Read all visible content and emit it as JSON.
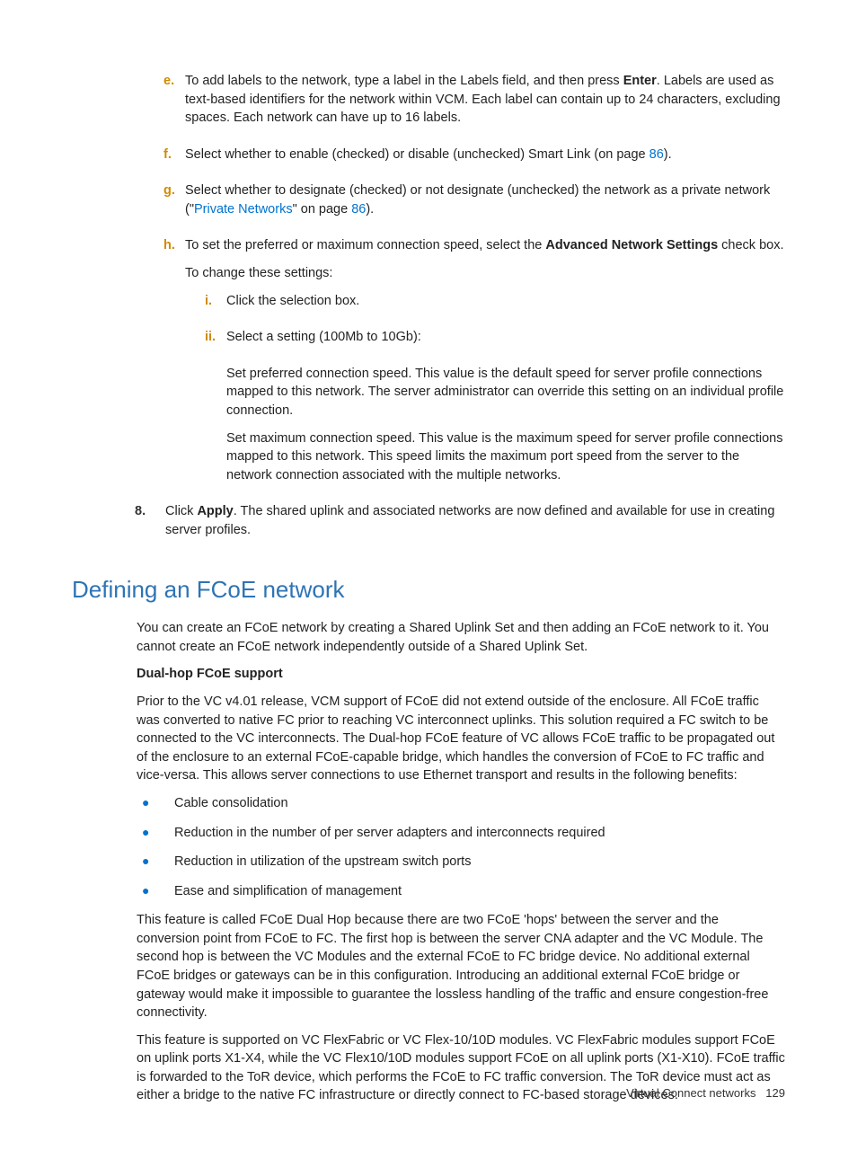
{
  "steps": {
    "e": {
      "marker": "e.",
      "text_pre": "To add labels to the network, type a label in the Labels field, and then press ",
      "bold": "Enter",
      "text_post": ". Labels are used as text-based identifiers for the network within VCM. Each label can contain up to 24 characters, excluding spaces. Each network can have up to 16 labels."
    },
    "f": {
      "marker": "f.",
      "text_pre": "Select whether to enable (checked) or disable (unchecked) Smart Link (on page ",
      "link": "86",
      "text_post": ")."
    },
    "g": {
      "marker": "g.",
      "text_pre": "Select whether to designate (checked) or not designate (unchecked) the network as a private network (\"",
      "link1": "Private Networks",
      "mid": "\" on page ",
      "link2": "86",
      "text_post": ")."
    },
    "h": {
      "marker": "h.",
      "text_pre": "To set the preferred or maximum connection speed, select the ",
      "bold": "Advanced Network Settings",
      "text_post": " check box.",
      "sub_intro": "To change these settings:",
      "i": {
        "marker": "i.",
        "text": "Click the selection box."
      },
      "ii": {
        "marker": "ii.",
        "text": "Select a setting (100Mb to 10Gb):",
        "p1": "Set preferred connection speed. This value is the default speed for server profile connections mapped to this network. The server administrator can override this setting on an individual profile connection.",
        "p2": "Set maximum connection speed. This value is the maximum speed for server profile connections mapped to this network. This speed limits the maximum port speed from the server to the network connection associated with the multiple networks."
      }
    },
    "s8": {
      "marker": "8.",
      "text_pre": "Click ",
      "bold": "Apply",
      "text_post": ". The shared uplink and associated networks are now defined and available for use in creating server profiles."
    }
  },
  "heading": "Defining an FCoE network",
  "body": {
    "p1": "You can create an FCoE network by creating a Shared Uplink Set and then adding an FCoE network to it. You cannot create an FCoE network independently outside of a Shared Uplink Set.",
    "sub": "Dual-hop FCoE support",
    "p2": "Prior to the VC v4.01 release, VCM support of FCoE did not extend outside of the enclosure. All FCoE traffic was converted to native FC prior to reaching VC interconnect uplinks. This solution required a FC switch to be connected to the VC interconnects. The Dual-hop FCoE feature of VC allows FCoE traffic to be propagated out of the enclosure to an external FCoE-capable bridge, which handles the conversion of FCoE to FC traffic and vice-versa. This allows server connections to use Ethernet transport and results in the following benefits:",
    "bullets": [
      "Cable consolidation",
      "Reduction in the number of per server adapters and interconnects required",
      "Reduction in utilization of the upstream switch ports",
      "Ease and simplification of management"
    ],
    "p3": "This feature is called FCoE Dual Hop because there are two FCoE 'hops' between the server and the conversion point from FCoE to FC. The first hop is between the server CNA adapter and the VC Module. The second hop is between the VC Modules and the external FCoE to FC bridge device. No additional external FCoE bridges or gateways can be in this configuration. Introducing an additional external FCoE bridge or gateway would make it impossible to guarantee the lossless handling of the traffic and ensure congestion-free connectivity.",
    "p4": "This feature is supported on VC FlexFabric or VC Flex-10/10D modules. VC FlexFabric modules support FCoE on uplink ports X1-X4, while the VC Flex10/10D modules support FCoE on all uplink ports (X1-X10). FCoE traffic is forwarded to the ToR device, which performs the FCoE to FC traffic conversion. The ToR device must act as either a bridge to the native FC infrastructure or directly connect to FC-based storage devices."
  },
  "footer": {
    "section": "Virtual Connect networks",
    "page": "129"
  }
}
